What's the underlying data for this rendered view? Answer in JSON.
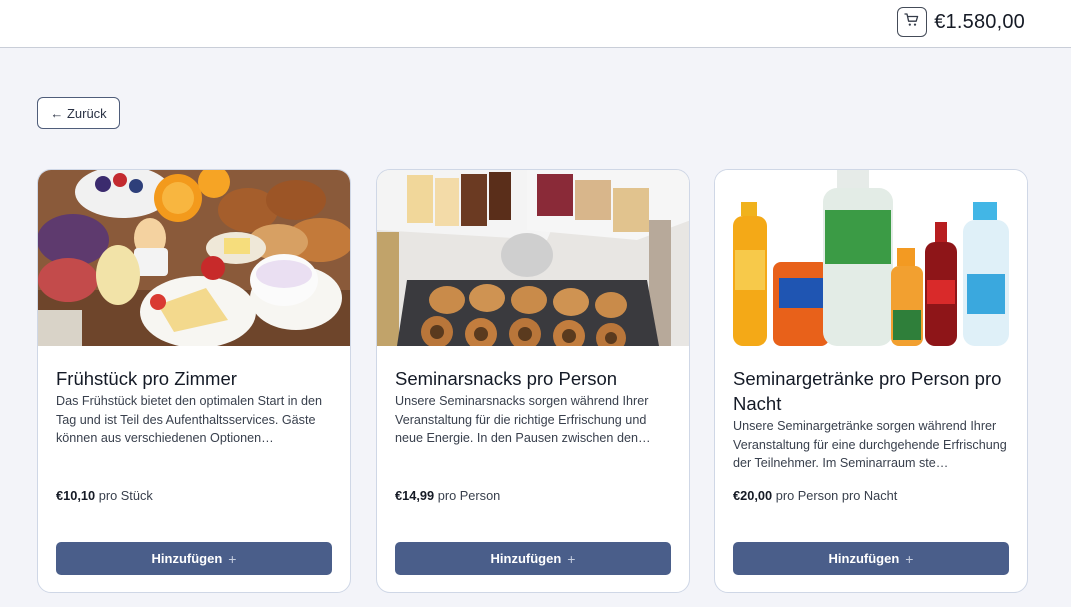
{
  "header": {
    "cart_total": "€1.580,00"
  },
  "nav": {
    "back_label": "← Zurück"
  },
  "products": [
    {
      "title": "Frühstück pro Zimmer",
      "description": "Das Frühstück bietet den optimalen Start in den Tag und ist Teil des Aufenthaltsservices. Gäste können aus verschiedenen Optionen…",
      "price": "€10,10",
      "unit": "pro Stück",
      "button_label": "Hinzufügen",
      "button_icon": "+"
    },
    {
      "title": "Seminarsnacks pro Person",
      "description": "Unsere Seminarsnacks sorgen während Ihrer Veranstaltung für die richtige Erfrischung und neue Energie. In den Pausen zwischen den…",
      "price": "€14,99",
      "unit": "pro Person",
      "button_label": "Hinzufügen",
      "button_icon": "+"
    },
    {
      "title": "Seminargetränke pro Person pro Nacht",
      "description": "Unsere Seminargetränke sorgen während Ihrer Veranstaltung für eine durchgehende Erfrischung der Teilnehmer. Im Seminarraum ste…",
      "price": "€20,00",
      "unit": "pro Person pro Nacht",
      "button_label": "Hinzufügen",
      "button_icon": "+"
    }
  ],
  "colors": {
    "primary_button": "#4a5e8a",
    "background": "#f3f4f9"
  },
  "icons": {
    "cart": "shopping-cart-icon",
    "add": "plus-icon"
  }
}
